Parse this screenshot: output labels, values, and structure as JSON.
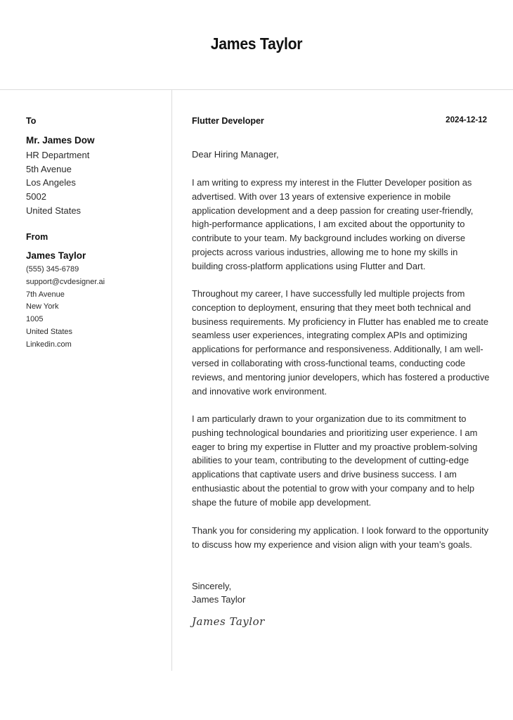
{
  "header": {
    "name": "James Taylor"
  },
  "recipient": {
    "section_label": "To",
    "name": "Mr. James Dow",
    "lines": [
      "HR Department",
      "5th Avenue",
      "Los Angeles",
      "5002",
      "United States"
    ]
  },
  "sender": {
    "section_label": "From",
    "name": "James Taylor",
    "lines": [
      "(555) 345-6789",
      "support@cvdesigner.ai",
      "7th Avenue",
      "New York",
      "1005",
      "United States",
      "Linkedin.com"
    ]
  },
  "letter": {
    "job_title": "Flutter Developer",
    "date": "2024-12-12",
    "salutation": "Dear Hiring Manager,",
    "paragraphs": [
      "I am writing to express my interest in the Flutter Developer position as advertised. With over 13 years of extensive experience in mobile application development and a deep passion for creating user-friendly, high-performance applications, I am excited about the opportunity to contribute to your team. My background includes working on diverse projects across various industries, allowing me to hone my skills in building cross-platform applications using Flutter and Dart.",
      "Throughout my career, I have successfully led multiple projects from conception to deployment, ensuring that they meet both technical and business requirements. My proficiency in Flutter has enabled me to create seamless user experiences, integrating complex APIs and optimizing applications for performance and responsiveness. Additionally, I am well-versed in collaborating with cross-functional teams, conducting code reviews, and mentoring junior developers, which has fostered a productive and innovative work environment.",
      "I am particularly drawn to your organization due to its commitment to pushing technological boundaries and prioritizing user experience. I am eager to bring my expertise in Flutter and my proactive problem-solving abilities to your team, contributing to the development of cutting-edge applications that captivate users and drive business success. I am enthusiastic about the potential to grow with your company and to help shape the future of mobile app development.",
      "Thank you for considering my application. I look forward to the opportunity to discuss how my experience and vision align with your team’s goals."
    ],
    "closing": "Sincerely,",
    "signer_name": "James Taylor",
    "signature": "James Taylor"
  }
}
